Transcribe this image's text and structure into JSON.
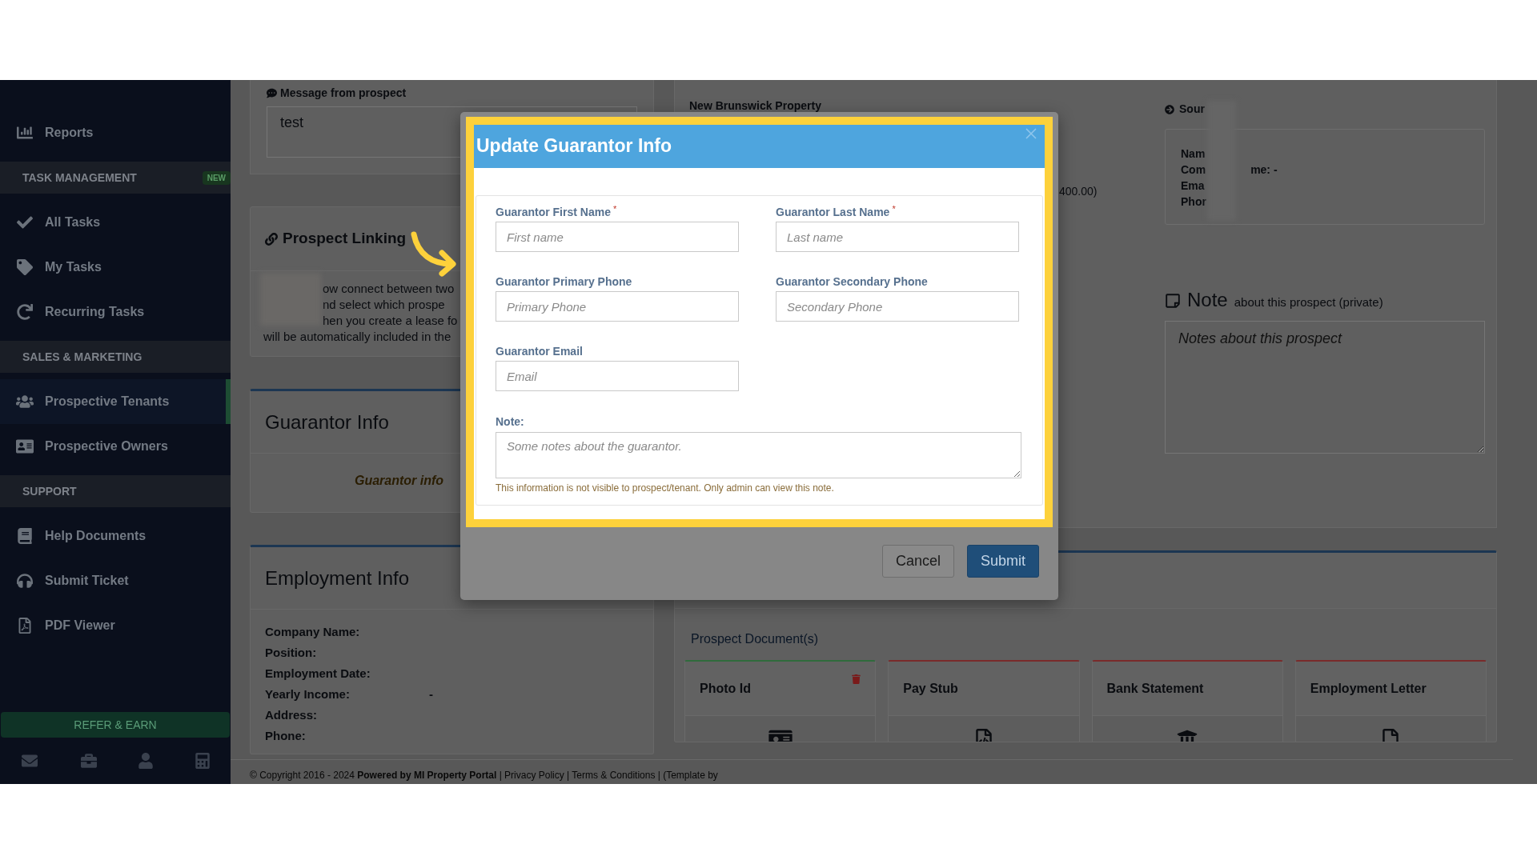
{
  "sidebar": {
    "items": [
      {
        "kind": "link",
        "label": "Reports",
        "selected": false
      },
      {
        "kind": "header",
        "label": "TASK MANAGEMENT",
        "badge": "NEW"
      },
      {
        "kind": "link",
        "label": "All Tasks",
        "selected": false
      },
      {
        "kind": "link",
        "label": "My Tasks",
        "selected": false
      },
      {
        "kind": "link",
        "label": "Recurring Tasks",
        "selected": false
      },
      {
        "kind": "header",
        "label": "SALES & MARKETING"
      },
      {
        "kind": "link",
        "label": "Prospective Tenants",
        "selected": true
      },
      {
        "kind": "link",
        "label": "Prospective Owners",
        "selected": false
      },
      {
        "kind": "header",
        "label": "SUPPORT"
      },
      {
        "kind": "link",
        "label": "Help Documents",
        "selected": false
      },
      {
        "kind": "link",
        "label": "Submit Ticket",
        "selected": false
      },
      {
        "kind": "link",
        "label": "PDF Viewer",
        "selected": false
      }
    ],
    "promo": "REFER & EARN"
  },
  "message": {
    "label": "Message from prospect",
    "value": "test"
  },
  "prospect_linking": {
    "title": "Prospect Linking",
    "lines": [
      "ow connect between two",
      "nd select which prospe",
      "hen you create a lease fo",
      "will be automatically included in the"
    ]
  },
  "guarantor_info": {
    "title": "Guarantor Info",
    "empty_text": "Guarantor info"
  },
  "employment_info": {
    "title": "Employment Info",
    "fields": [
      {
        "label": "Company Name:"
      },
      {
        "label": "Position:"
      },
      {
        "label": "Employment Date:"
      },
      {
        "label": "Yearly Income:",
        "value": "-"
      },
      {
        "label": "Address:"
      },
      {
        "label": "Phone:"
      }
    ]
  },
  "property": {
    "name": "New Brunswick Property",
    "amount_fragment": "400.00)"
  },
  "reference": {
    "source_label": "Sour",
    "lines": [
      {
        "label": "Nam"
      },
      {
        "label": "Com",
        "value": "me: -"
      },
      {
        "label": "Ema"
      },
      {
        "label": "Phor"
      }
    ]
  },
  "note": {
    "title": "Note",
    "subtitle": "about this prospect (private)",
    "placeholder": "Notes about this prospect"
  },
  "documents": {
    "title": "Prospect Document(s)",
    "items": [
      {
        "label": "Photo Id",
        "color": "#2f6b3c",
        "deletable": true
      },
      {
        "label": "Pay Stub",
        "color": "#7a2a2a",
        "deletable": false
      },
      {
        "label": "Bank Statement",
        "color": "#7a2a2a",
        "deletable": false
      },
      {
        "label": "Employment Letter",
        "color": "#7a2a2a",
        "deletable": false
      }
    ]
  },
  "footer": "© Copyright 2016 - 2024 **Powered by MI Property Portal** | Privacy Policy | Terms & Conditions | (Template by",
  "modal": {
    "title": "Update Guarantor Info",
    "fields": [
      {
        "label": "Guarantor First Name",
        "required_mark": "*",
        "placeholder": "First name"
      },
      {
        "label": "Guarantor Last Name",
        "required_mark": "*",
        "placeholder": "Last name"
      },
      {
        "label": "Guarantor Primary Phone",
        "placeholder": "Primary Phone"
      },
      {
        "label": "Guarantor Secondary Phone",
        "placeholder": "Secondary Phone"
      },
      {
        "label": "Guarantor Email",
        "placeholder": "Email"
      }
    ],
    "note_label": "Note:",
    "note_placeholder": "Some notes about the guarantor.",
    "note_help": "This information is not visible to prospect/tenant. Only admin can view this note.",
    "buttons": [
      {
        "kind": "secondary",
        "label": "Cancel"
      },
      {
        "kind": "primary",
        "label": "Submit"
      }
    ]
  }
}
